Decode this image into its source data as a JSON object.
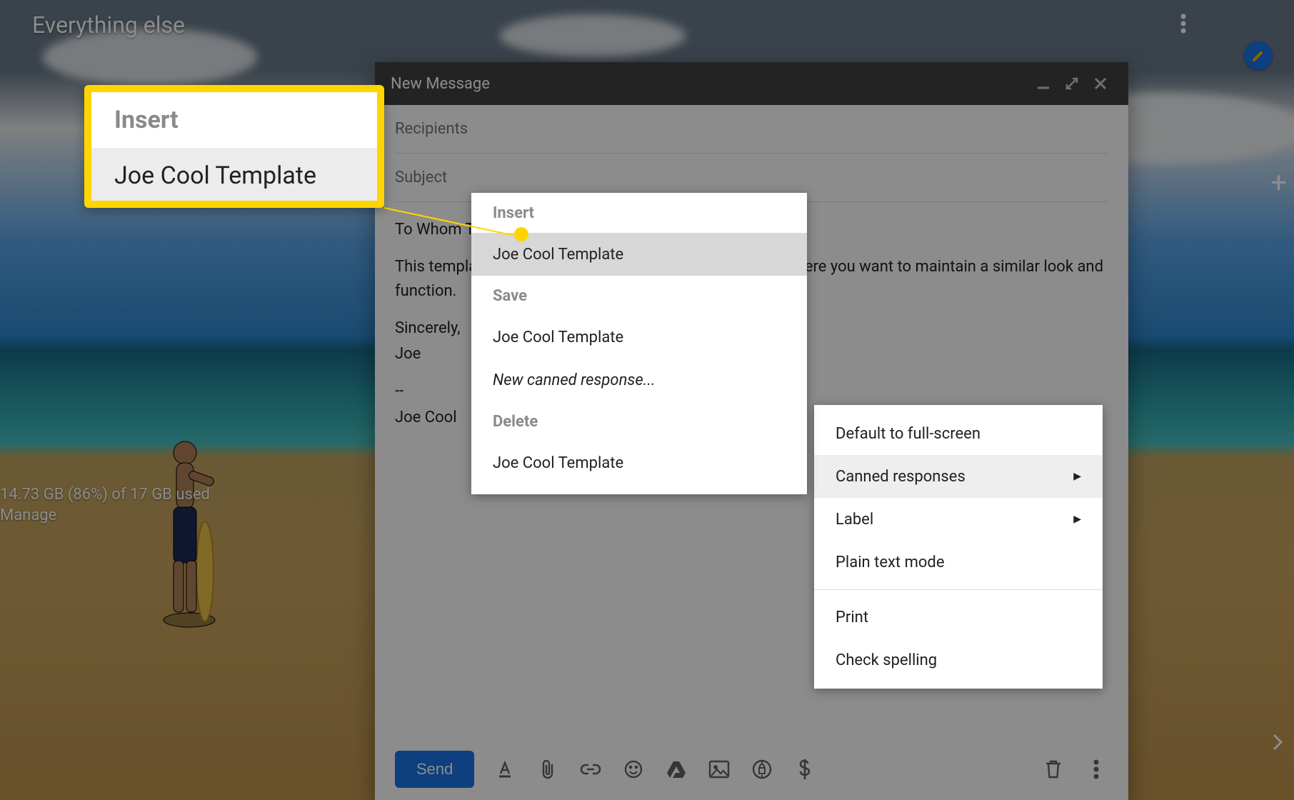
{
  "topbar": {
    "label": "Everything else"
  },
  "storage": {
    "used_text": "14.73 GB (86%) of 17 GB used",
    "manage_link": "Manage"
  },
  "compose": {
    "title": "New Message",
    "recipients_placeholder": "Recipients",
    "subject_placeholder": "Subject",
    "body_lines": [
      "To Whom This May Concern,",
      "This template is designed to be used for generic replies where you want to maintain a similar look and function.",
      "Sincerely,",
      "Joe",
      "--",
      "Joe Cool"
    ],
    "send_label": "Send"
  },
  "more_menu": {
    "items": [
      {
        "label": "Default to full-screen",
        "arrow": false
      },
      {
        "label": "Canned responses",
        "arrow": true,
        "hover": true
      },
      {
        "label": "Label",
        "arrow": true
      },
      {
        "label": "Plain text mode",
        "arrow": false
      }
    ],
    "items2": [
      {
        "label": "Print"
      },
      {
        "label": "Check spelling"
      }
    ]
  },
  "canned_menu": {
    "sections": [
      {
        "header": "Insert",
        "items": [
          {
            "label": "Joe Cool Template",
            "hover": true
          }
        ]
      },
      {
        "header": "Save",
        "items": [
          {
            "label": "Joe Cool Template"
          },
          {
            "label": "New canned response...",
            "italic": true
          }
        ]
      },
      {
        "header": "Delete",
        "items": [
          {
            "label": "Joe Cool Template"
          }
        ]
      }
    ]
  },
  "callout": {
    "header": "Insert",
    "item": "Joe Cool Template"
  },
  "colors": {
    "accent": "#1a73e8",
    "highlight_border": "#ffd500"
  }
}
